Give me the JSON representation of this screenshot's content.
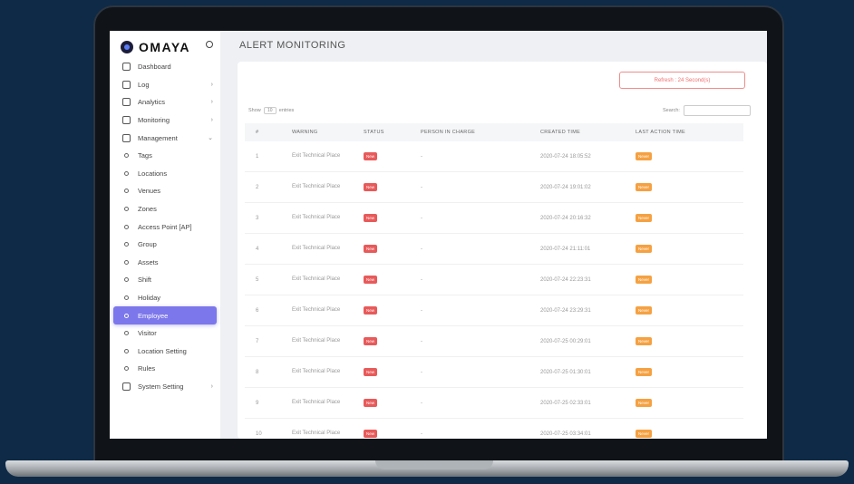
{
  "brand": {
    "name": "OMAYA"
  },
  "sidebar": {
    "items": [
      {
        "label": "Dashboard",
        "icon": "home-icon",
        "type": "main"
      },
      {
        "label": "Log",
        "icon": "file-icon",
        "type": "main",
        "chevron": "›"
      },
      {
        "label": "Analytics",
        "icon": "clock-icon",
        "type": "main",
        "chevron": "›"
      },
      {
        "label": "Monitoring",
        "icon": "monitor-icon",
        "type": "main",
        "chevron": "›"
      },
      {
        "label": "Management",
        "icon": "server-icon",
        "type": "main",
        "chevron": "⌄"
      },
      {
        "label": "Tags",
        "type": "sub"
      },
      {
        "label": "Locations",
        "type": "sub"
      },
      {
        "label": "Venues",
        "type": "sub"
      },
      {
        "label": "Zones",
        "type": "sub"
      },
      {
        "label": "Access Point [AP]",
        "type": "sub"
      },
      {
        "label": "Group",
        "type": "sub"
      },
      {
        "label": "Assets",
        "type": "sub"
      },
      {
        "label": "Shift",
        "type": "sub"
      },
      {
        "label": "Holiday",
        "type": "sub"
      },
      {
        "label": "Employee",
        "type": "sub",
        "active": true
      },
      {
        "label": "Visitor",
        "type": "sub"
      },
      {
        "label": "Location Setting",
        "type": "sub"
      },
      {
        "label": "Rules",
        "type": "sub"
      },
      {
        "label": "System Setting",
        "icon": "gear-icon",
        "type": "main",
        "chevron": "›"
      }
    ]
  },
  "page": {
    "title": "ALERT MONITORING"
  },
  "toolbar": {
    "refresh_label": "Refresh : 24 Second(s)",
    "show_label": "Show",
    "show_value": "10",
    "entries_label": "entries",
    "search_label": "Search:"
  },
  "table": {
    "columns": [
      "#",
      "WARNING",
      "STATUS",
      "PERSON IN CHARGE",
      "CREATED TIME",
      "LAST ACTION TIME"
    ],
    "rows": [
      {
        "no": "1",
        "warning": "Exit Technical Place",
        "status": "New",
        "person": "-",
        "created": "2020-07-24 18:05:52",
        "last": "Never"
      },
      {
        "no": "2",
        "warning": "Exit Technical Place",
        "status": "New",
        "person": "-",
        "created": "2020-07-24 19:01:02",
        "last": "Never"
      },
      {
        "no": "3",
        "warning": "Exit Technical Place",
        "status": "New",
        "person": "-",
        "created": "2020-07-24 20:16:32",
        "last": "Never"
      },
      {
        "no": "4",
        "warning": "Exit Technical Place",
        "status": "New",
        "person": "-",
        "created": "2020-07-24 21:11:01",
        "last": "Never"
      },
      {
        "no": "5",
        "warning": "Exit Technical Place",
        "status": "New",
        "person": "-",
        "created": "2020-07-24 22:23:31",
        "last": "Never"
      },
      {
        "no": "6",
        "warning": "Exit Technical Place",
        "status": "New",
        "person": "-",
        "created": "2020-07-24 23:29:31",
        "last": "Never"
      },
      {
        "no": "7",
        "warning": "Exit Technical Place",
        "status": "New",
        "person": "-",
        "created": "2020-07-25 00:29:01",
        "last": "Never"
      },
      {
        "no": "8",
        "warning": "Exit Technical Place",
        "status": "New",
        "person": "-",
        "created": "2020-07-25 01:30:01",
        "last": "Never"
      },
      {
        "no": "9",
        "warning": "Exit Technical Place",
        "status": "New",
        "person": "-",
        "created": "2020-07-25 02:33:01",
        "last": "Never"
      },
      {
        "no": "10",
        "warning": "Exit Technical Place",
        "status": "New",
        "person": "-",
        "created": "2020-07-25 03:34:01",
        "last": "Never"
      }
    ]
  },
  "colors": {
    "accent": "#7c77ea",
    "status_new": "#e85a5a",
    "last_action": "#f5a142",
    "background": "#0e2a47"
  }
}
